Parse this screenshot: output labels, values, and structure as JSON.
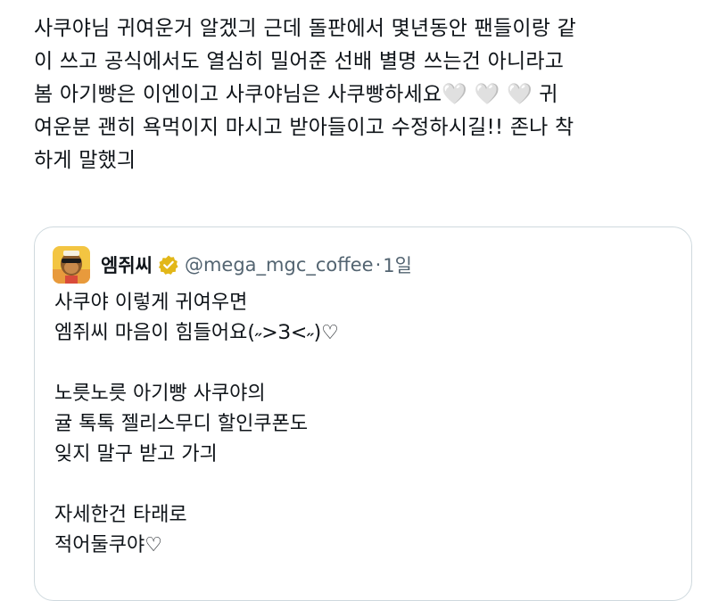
{
  "tweet": {
    "text": "사쿠야님 귀여운거 알겠긔 근데 돌판에서 몇년동안 팬들이랑 같\n이 쓰고 공식에서도 열심히 밀어준 선배 별명 쓰는건 아니라고\n봄 아기빵은 이엔이고 사쿠야님은 사쿠빵하세요🤍 🤍 🤍 귀\n여운분 괜히 욕먹이지 마시고 받아들이고 수정하시길!! 존나 착\n하게 말했긔"
  },
  "quote": {
    "display_name": "엠쥐씨",
    "handle": "@mega_mgc_coffee",
    "separator": "·",
    "time": "1일",
    "verified_icon": "gold-verified-badge",
    "avatar_icon": "cartoon-mascot-avatar",
    "body": "사쿠야 이렇게 귀여우면\n엠쥐씨 마음이 힘들어요(˶>З<˶)♡\n\n노릇노릇 아기빵 사쿠야의\n귤 톡톡 젤리스무디 할인쿠폰도\n잊지 말구 받고 가긔\n\n자세한건 타래로\n적어둘쿠야♡"
  },
  "colors": {
    "text": "#0f1419",
    "secondary_text": "#536471",
    "border": "#cfd9de",
    "verified_gold": "#e2b719"
  }
}
